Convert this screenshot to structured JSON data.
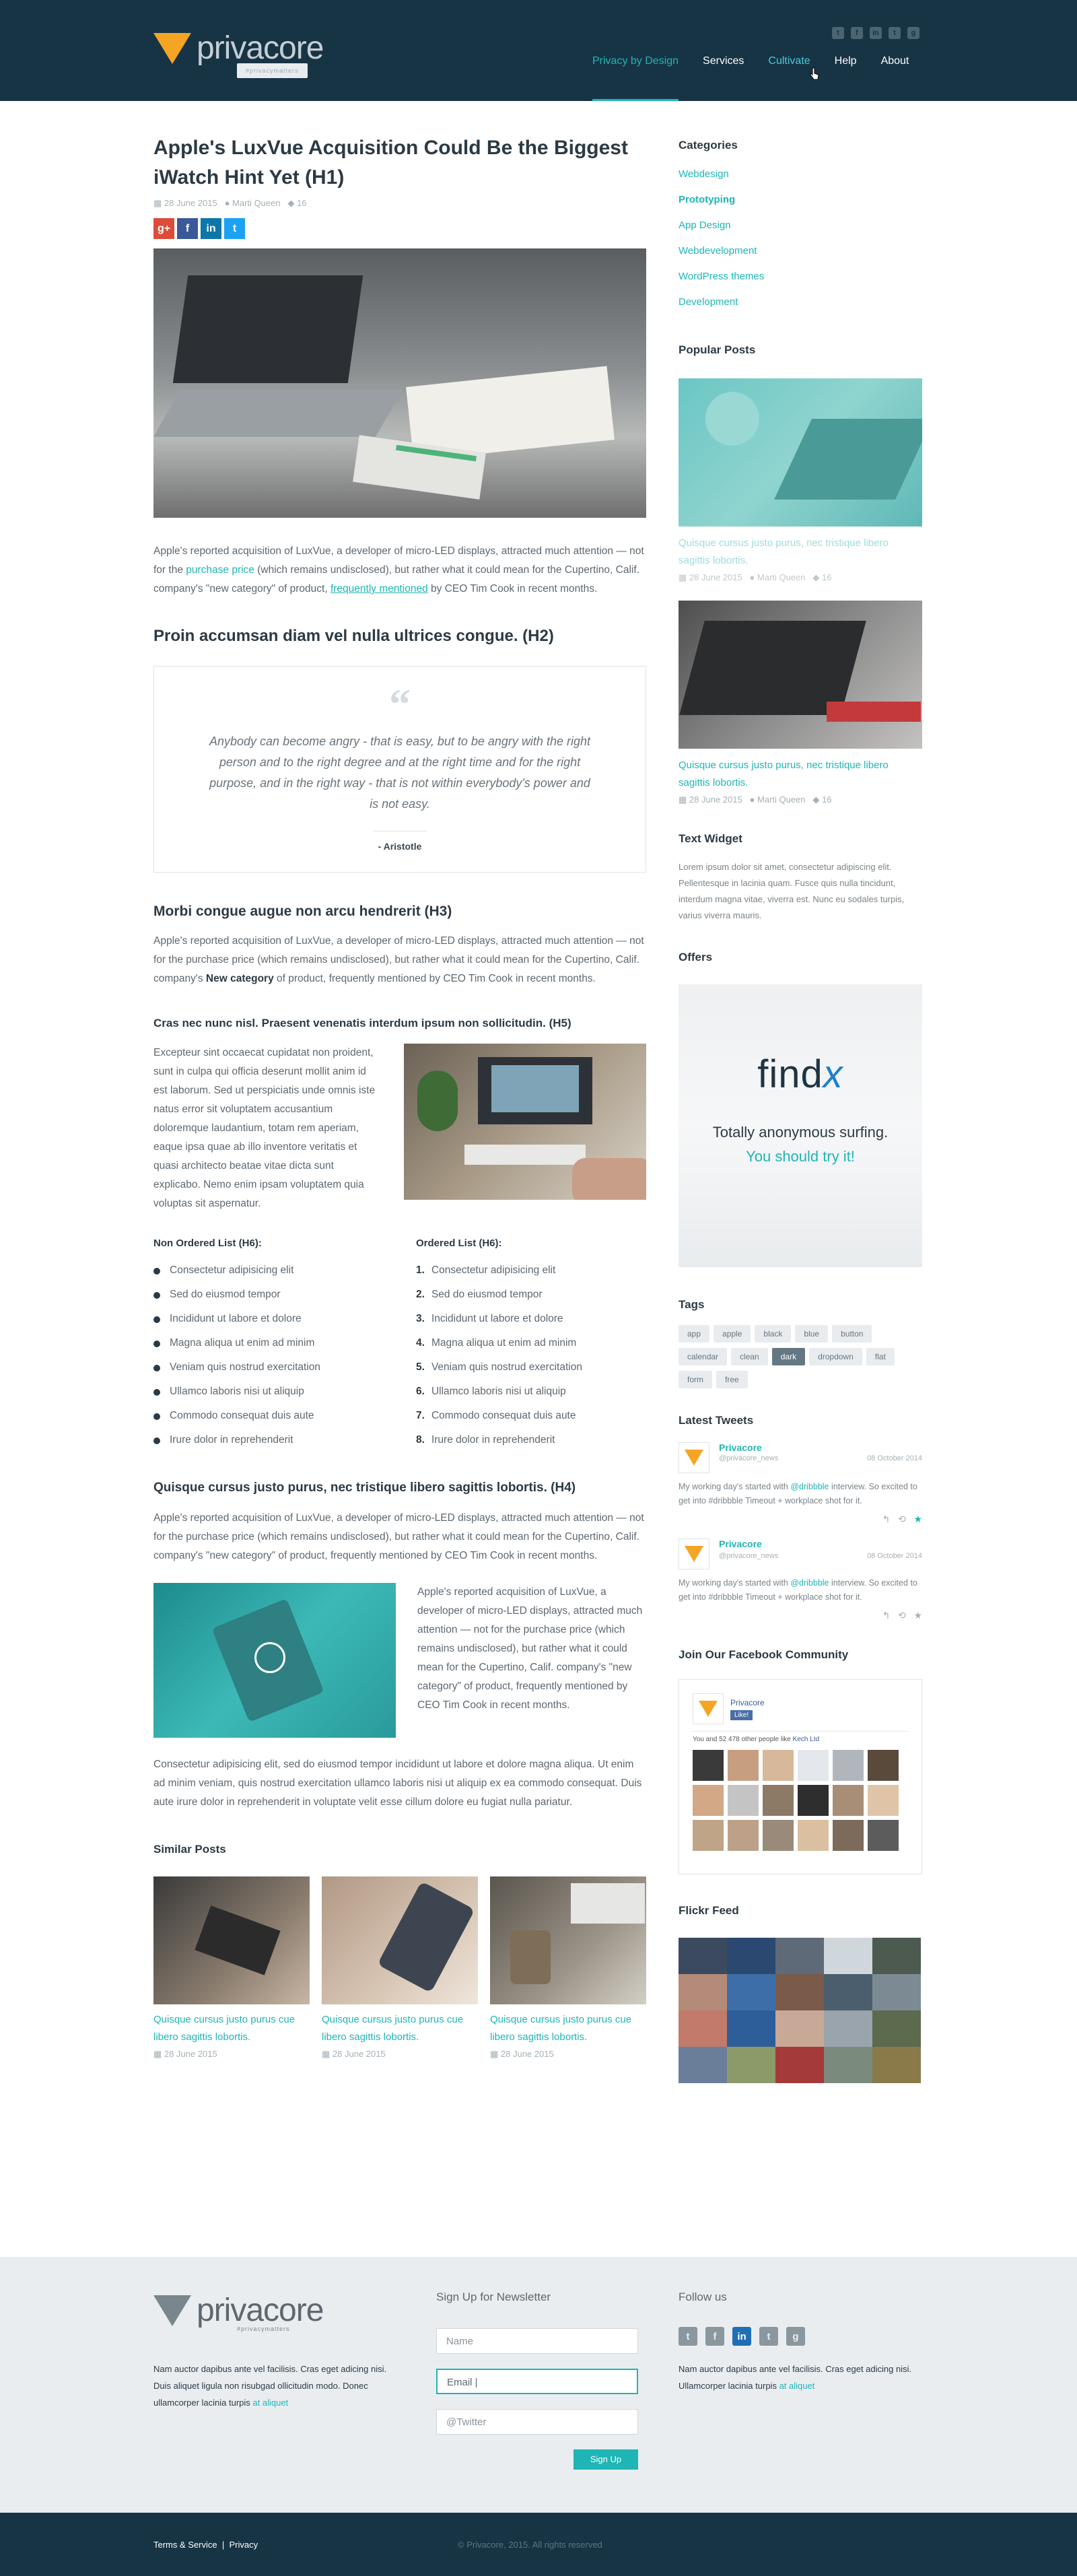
{
  "brand": {
    "name": "privacore",
    "tagline": "#privacymatters"
  },
  "nav": [
    "Privacy by Design",
    "Services",
    "Cultivate",
    "Help",
    "About"
  ],
  "header_icons": [
    "twitter-icon",
    "facebook-icon",
    "linkedin-icon",
    "tumblr-icon",
    "github-icon"
  ],
  "article": {
    "title": "Apple's LuxVue Acquisition Could Be the Biggest iWatch Hint Yet (H1)",
    "date": "28 June 2015",
    "author": "Marti Queen",
    "comments": "16",
    "p1_a": "Apple's reported acquisition of LuxVue, a developer of micro-LED displays, attracted much attention — not for the ",
    "p1_link": "purchase price",
    "p1_b": " (which remains undisclosed), but rather what it could mean for the Cupertino, Calif. company's \"new category\" of product, ",
    "p1_link2": "frequently mentioned",
    "p1_c": " by CEO Tim Cook in recent months.",
    "h2": "Proin accumsan diam vel nulla ultrices congue. (H2)",
    "quote": "Anybody can become angry - that is easy, but to be angry with the right person and to the right degree and at the right time and for the right purpose, and in the right way - that is not within everybody's power and is not easy.",
    "quote_author": "- Aristotle",
    "h3": "Morbi congue augue non arcu hendrerit (H3)",
    "p2_a": "Apple's reported acquisition of LuxVue, a developer of micro-LED displays, attracted much attention — not for the purchase price (which remains undisclosed), but rather what it could mean for the Cupertino, Calif. company's ",
    "p2_bold": "New category",
    "p2_b": " of product, frequently mentioned by CEO Tim Cook in recent months.",
    "h5": "Cras nec nunc nisl. Praesent venenatis interdum ipsum non sollicitudin. (H5)",
    "p3": "Excepteur sint occaecat cupidatat non proident, sunt in culpa qui officia deserunt mollit anim id est laborum. Sed ut perspiciatis unde omnis iste natus error sit voluptatem accusantium doloremque laudantium, totam rem aperiam, eaque ipsa quae ab illo inventore veritatis et quasi architecto beatae vitae dicta sunt explicabo. Nemo enim ipsam voluptatem quia voluptas sit aspernatur.",
    "ul_title": "Non Ordered List (H6):",
    "ol_title": "Ordered List (H6):",
    "list": [
      "Consectetur adipisicing elit",
      "Sed do eiusmod tempor",
      "Incididunt ut labore et dolore",
      "Magna aliqua ut enim ad minim",
      "Veniam quis nostrud exercitation",
      "Ullamco laboris nisi ut aliquip",
      "Commodo consequat duis aute",
      "Irure dolor in reprehenderit"
    ],
    "h4": "Quisque cursus justo purus, nec tristique libero sagittis lobortis. (H4)",
    "p4": "Apple's reported acquisition of LuxVue, a developer of micro-LED displays, attracted much attention — not for the purchase price (which remains undisclosed), but rather what it could mean for the Cupertino, Calif. company's \"new category\" of product, frequently mentioned by CEO Tim Cook in recent months.",
    "p5": "Apple's reported acquisition of LuxVue, a developer of micro-LED displays, attracted much attention — not for the purchase price (which remains undisclosed), but rather what it could mean for the Cupertino, Calif. company's \"new category\" of product, frequently mentioned by CEO Tim Cook in recent months.",
    "p6": "Consectetur adipisicing elit, sed do eiusmod tempor incididunt ut labore et dolore magna aliqua. Ut enim ad minim veniam, quis nostrud exercitation ullamco laboris nisi ut aliquip ex ea commodo consequat. Duis aute irure dolor in reprehenderit in voluptate velit esse cillum dolore eu fugiat nulla pariatur.",
    "similar_title": "Similar Posts",
    "similar": [
      {
        "title": "Quisque cursus justo purus cue libero sagittis lobortis.",
        "date": "28 June 2015"
      },
      {
        "title": "Quisque cursus justo purus cue libero sagittis lobortis.",
        "date": "28 June 2015"
      },
      {
        "title": "Quisque cursus justo purus cue libero sagittis lobortis.",
        "date": "28 June 2015"
      }
    ]
  },
  "sidebar": {
    "categories_title": "Categories",
    "categories": [
      "Webdesign",
      "Prototyping",
      "App Design",
      "Webdevelopment",
      "WordPress themes",
      "Development"
    ],
    "popular_title": "Popular Posts",
    "popular": [
      {
        "title": "Quisque cursus justo purus, nec tristique libero sagittis lobortis.",
        "date": "28 June 2015",
        "author": "Marti Queen",
        "comments": "16"
      },
      {
        "title": "Quisque cursus justo purus, nec tristique libero sagittis lobortis.",
        "date": "28 June 2015",
        "author": "Marti Queen",
        "comments": "16"
      }
    ],
    "text_widget_title": "Text Widget",
    "text_widget": "Lorem ipsum dolor sit amet, consectetur adipiscing elit. Pellentesque in lacinia quam. Fusce quis nulla tincidunt, interdum magna vitae, viverra est. Nunc eu sodales turpis, varius viverra mauris.",
    "offers_title": "Offers",
    "offer_logo": "find",
    "offer_logo_x": "x",
    "offer_line1": "Totally anonymous surfing.",
    "offer_line2": "You should try it!",
    "tags_title": "Tags",
    "tags": [
      "app",
      "apple",
      "black",
      "blue",
      "button",
      "calendar",
      "clean",
      "dark",
      "dropdown",
      "flat",
      "form",
      "free"
    ],
    "tweets_title": "Latest Tweets",
    "tweets": [
      {
        "name": "Privacore",
        "handle": "@privacore_news",
        "date": "08 October 2014",
        "a": "My working day's started with ",
        "link": "@dribbble",
        "b": " interview. So excited to get into #dribbble Timeout + workplace shot for it."
      },
      {
        "name": "Privacore",
        "handle": "@privacore_news",
        "date": "08 October 2014",
        "a": "My working day's started with ",
        "link": "@dribbble",
        "b": " interview. So excited to get into #dribbble Timeout + workplace shot for it."
      }
    ],
    "fb_title": "Join Our Facebook Community",
    "fb_name": "Privacore",
    "fb_like": "Like!",
    "fb_count": "You and 52 478 other people like ",
    "fb_count_link": "Kech Ltd",
    "flickr_title": "Flickr Feed"
  },
  "footer": {
    "about": "Nam auctor dapibus ante vel facilisis. Cras eget adicing nisi. Duis aliquet ligula non risubgad ollicitudin modo. Donec ullamcorper lacinia turpis ",
    "about_link": "at aliquet",
    "newsletter_title": "Sign Up for Newsletter",
    "name_placeholder": "Name",
    "email_value": "Email",
    "twitter_placeholder": "@Twitter",
    "signup": "Sign Up",
    "follow_title": "Follow us",
    "follow_text": "Nam auctor dapibus ante vel facilisis. Cras eget adicing nisi. Ullamcorper lacinia turpis ",
    "follow_link": "at aliquet",
    "terms": "Terms & Service",
    "privacy": "Privacy",
    "copyright": "© Privacore, 2015. All rights reserved"
  },
  "colors": {
    "accent": "#1fb5b5",
    "dark": "#173444",
    "orange": "#f5a524"
  }
}
